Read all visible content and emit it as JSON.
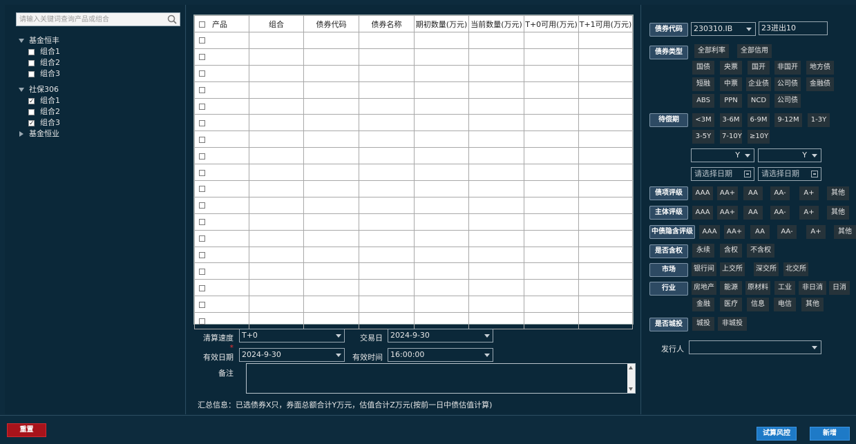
{
  "search": {
    "placeholder": "请输入关键词查询产品或组合"
  },
  "tree": [
    {
      "label": "基金恒丰",
      "expanded": true,
      "children": [
        {
          "label": "组合1",
          "checked": false
        },
        {
          "label": "组合2",
          "checked": false
        },
        {
          "label": "组合3",
          "checked": false
        }
      ]
    },
    {
      "label": "社保306",
      "expanded": true,
      "children": [
        {
          "label": "组合1",
          "checked": true
        },
        {
          "label": "组合2",
          "checked": false
        },
        {
          "label": "组合3",
          "checked": true
        }
      ]
    },
    {
      "label": "基金恒业",
      "expanded": false,
      "children": []
    }
  ],
  "table": {
    "columns": [
      "产品",
      "组合",
      "债券代码",
      "债券名称",
      "期初数量(万元)",
      "当前数量(万元)",
      "T+0可用(万元)",
      "T+1可用(万元)"
    ],
    "row_count": 18
  },
  "form": {
    "clearing_label": "清算速度",
    "clearing_value": "T+0",
    "trade_date_label": "交易日",
    "trade_date_value": "2024-9-30",
    "effective_date_label": "有效日期",
    "effective_date_value": "2024-9-30",
    "effective_time_label": "有效时间",
    "effective_time_value": "16:00:00",
    "remark_label": "备注"
  },
  "summary": "汇总信息：已选债券X只，券面总额合计Y万元，估值合计Z万元(按前一日中债估值计算)",
  "filters": {
    "bond_code": {
      "label": "债券代码",
      "value": "230310.IB",
      "name_value": "23进出10"
    },
    "bond_type": {
      "label": "债券类型",
      "tags": [
        "全部利率",
        "全部信用",
        "国债",
        "央票",
        "国开",
        "非国开",
        "地方债",
        "短融",
        "中票",
        "企业债",
        "公司债",
        "金融债",
        "ABS",
        "PPN",
        "NCD",
        "公司债"
      ]
    },
    "maturity": {
      "label": "待偿期",
      "tags": [
        "<3M",
        "3-6M",
        "6-9M",
        "9-12M",
        "1-3Y",
        "3-5Y",
        "7-10Y",
        "≥10Y"
      ],
      "unit1": "Y",
      "unit2": "Y",
      "date_placeholder1": "请选择日期",
      "date_placeholder2": "请选择日期"
    },
    "bond_rating": {
      "label": "债项评级",
      "tags": [
        "AAA",
        "AA+",
        "AA",
        "AA-",
        "A+",
        "其他"
      ]
    },
    "issuer_rating": {
      "label": "主体评级",
      "tags": [
        "AAA",
        "AA+",
        "AA",
        "AA-",
        "A+",
        "其他"
      ]
    },
    "implied_rating": {
      "label": "中债隐含评级",
      "tags": [
        "AAA",
        "AA+",
        "AA",
        "AA-",
        "A+",
        "其他"
      ]
    },
    "option": {
      "label": "是否含权",
      "tags": [
        "永续",
        "含权",
        "不含权"
      ]
    },
    "market": {
      "label": "市场",
      "tags": [
        "银行间",
        "上交所",
        "深交所",
        "北交所"
      ]
    },
    "industry": {
      "label": "行业",
      "tags": [
        "房地产",
        "能源",
        "原材料",
        "工业",
        "非日消",
        "日消",
        "金融",
        "医疗",
        "信息",
        "电信",
        "其他"
      ]
    },
    "chengtou": {
      "label": "是否城投",
      "tags": [
        "城投",
        "非城投"
      ]
    },
    "issuer": {
      "label": "发行人",
      "value": ""
    }
  },
  "footer": {
    "reset": "重置",
    "risk_check": "试算风控",
    "add": "新增"
  }
}
